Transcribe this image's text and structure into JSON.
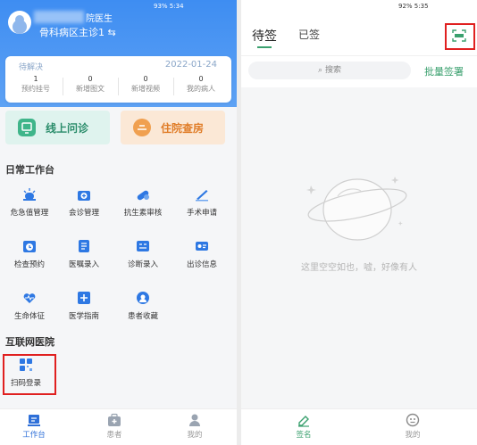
{
  "left": {
    "status_time": "5:34",
    "status_battery": "93%",
    "doctor_name": "院医生",
    "department": "骨科病区主诊1 ⇆",
    "card": {
      "label": "待解决",
      "date": "2022-01-24",
      "stats": [
        {
          "value": "1",
          "label": "预约挂号"
        },
        {
          "value": "0",
          "label": "新增图文"
        },
        {
          "value": "0",
          "label": "新增视频"
        },
        {
          "value": "0",
          "label": "我的病人"
        }
      ]
    },
    "big_buttons": {
      "online": "线上问诊",
      "ward": "住院查房"
    },
    "section_daily": "日常工作台",
    "daily_items": [
      {
        "label": "危急值管理",
        "icon": "alarm-icon"
      },
      {
        "label": "会诊管理",
        "icon": "medkit-icon"
      },
      {
        "label": "抗生素审核",
        "icon": "pill-icon"
      },
      {
        "label": "手术申请",
        "icon": "scalpel-icon"
      },
      {
        "label": "检查预约",
        "icon": "clock-icon"
      },
      {
        "label": "医嘱录入",
        "icon": "document-icon"
      },
      {
        "label": "诊断录入",
        "icon": "form-icon"
      },
      {
        "label": "出诊信息",
        "icon": "id-card-icon"
      },
      {
        "label": "生命体征",
        "icon": "heartbeat-icon"
      },
      {
        "label": "医学指南",
        "icon": "guide-icon"
      },
      {
        "label": "患者收藏",
        "icon": "star-icon"
      }
    ],
    "section_internet": "互联网医院",
    "scan_login": "扫码登录",
    "tabs": [
      {
        "label": "工作台",
        "icon": "dashboard-icon"
      },
      {
        "label": "患者",
        "icon": "medbox-icon"
      },
      {
        "label": "我的",
        "icon": "user-icon"
      }
    ]
  },
  "right": {
    "status_time": "5:35",
    "status_battery": "92%",
    "tabs": {
      "pending": "待签",
      "signed": "已签"
    },
    "search_placeholder": "搜索",
    "bulk_sign": "批量签署",
    "empty_text": "这里空空如也，嘘，好像有人",
    "bottom_tabs": [
      {
        "label": "签名",
        "icon": "pen-icon"
      },
      {
        "label": "我的",
        "icon": "face-icon"
      }
    ]
  },
  "colors": {
    "primary_blue": "#3e8df2",
    "highlight_red": "#e02020",
    "accent_green": "#3aa06e",
    "online_bg": "#dff3ee",
    "ward_bg": "#fbe8d6"
  }
}
